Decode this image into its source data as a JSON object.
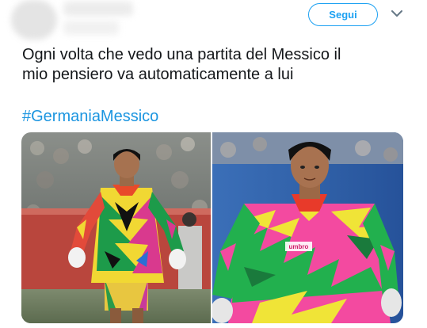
{
  "header": {
    "follow_label": "Segui",
    "more_icon": "chevron-down-icon"
  },
  "tweet": {
    "text_line1": "Ogni volta che vedo una partita del Messico il",
    "text_line2": "mio pensiero va automaticamente a lui",
    "hashtag": "#GermaniaMessico"
  },
  "media": {
    "photo_left_badge": "",
    "photo_right_badge": "umbro"
  },
  "colors": {
    "accent": "#1da1f2",
    "hashtag": "#1b95e0",
    "text": "#14171a"
  }
}
